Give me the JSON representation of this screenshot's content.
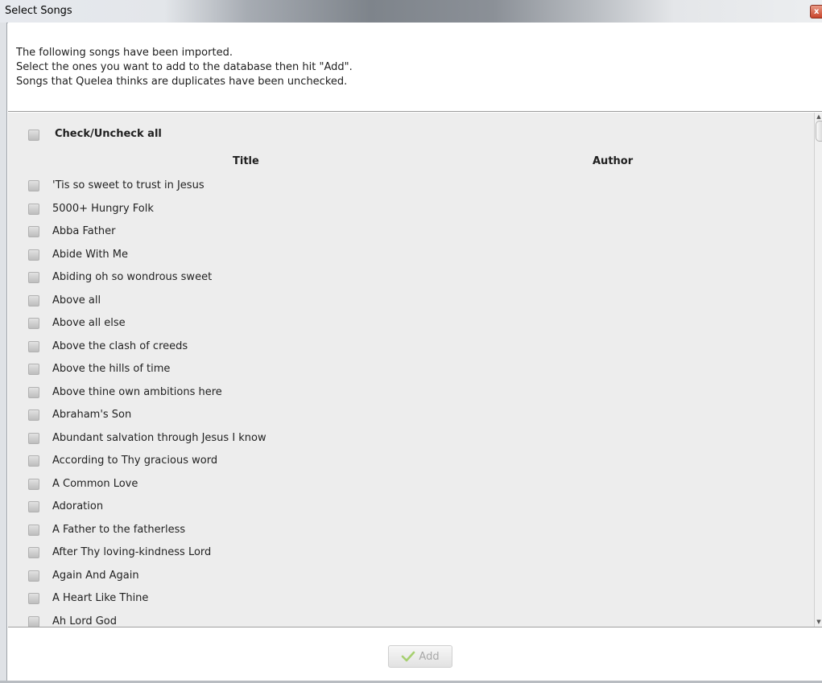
{
  "window": {
    "title": "Select Songs",
    "close_glyph": "x"
  },
  "header": {
    "lines": [
      "The following songs have been imported.",
      "Select the ones you want to add to the database then hit \"Add\".",
      "Songs that Quelea thinks are duplicates have been unchecked."
    ]
  },
  "list": {
    "check_all_label": "Check/Uncheck all",
    "check_all_checked": false,
    "columns": {
      "title": "Title",
      "author": "Author"
    },
    "songs": [
      {
        "title": "'Tis so sweet to trust in Jesus",
        "checked": false
      },
      {
        "title": "5000+ Hungry Folk",
        "checked": false
      },
      {
        "title": "Abba Father",
        "checked": false
      },
      {
        "title": "Abide With Me",
        "checked": false
      },
      {
        "title": "Abiding oh so wondrous sweet",
        "checked": false
      },
      {
        "title": "Above all",
        "checked": false
      },
      {
        "title": "Above all else",
        "checked": false
      },
      {
        "title": "Above the clash of creeds",
        "checked": false
      },
      {
        "title": "Above the hills of time",
        "checked": false
      },
      {
        "title": "Above thine own ambitions here",
        "checked": false
      },
      {
        "title": "Abraham's Son",
        "checked": false
      },
      {
        "title": "Abundant salvation through Jesus I know",
        "checked": false
      },
      {
        "title": "According to Thy gracious word",
        "checked": false
      },
      {
        "title": "A Common Love",
        "checked": false
      },
      {
        "title": "Adoration",
        "checked": false
      },
      {
        "title": "A Father to the fatherless",
        "checked": false
      },
      {
        "title": "After Thy loving-kindness Lord",
        "checked": false
      },
      {
        "title": "Again And Again",
        "checked": false
      },
      {
        "title": "A Heart Like Thine",
        "checked": false
      },
      {
        "title": "Ah Lord God",
        "checked": false
      }
    ]
  },
  "footer": {
    "add_label": "Add",
    "add_enabled": false,
    "add_icon": "checkmark-icon"
  },
  "colors": {
    "list_background": "#ededed",
    "checkmark": "#a6d070",
    "disabled_text": "#a8a8a8"
  }
}
